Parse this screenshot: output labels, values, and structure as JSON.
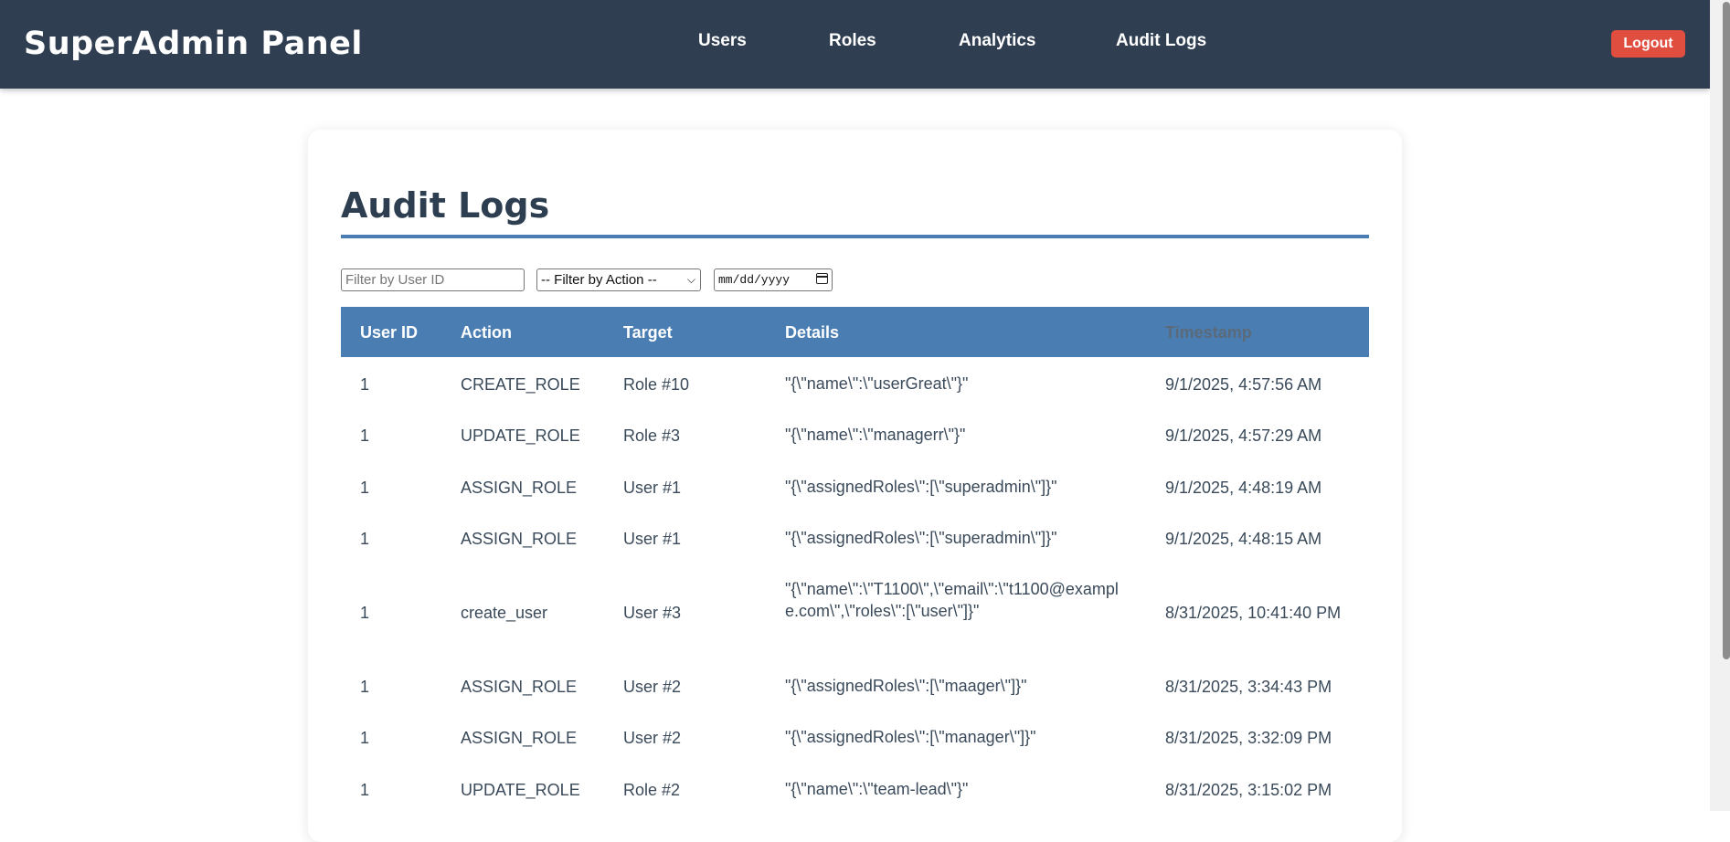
{
  "header": {
    "brand": "SuperAdmin Panel",
    "nav": [
      "Users",
      "Roles",
      "Analytics",
      "Audit Logs"
    ],
    "logout_label": "Logout"
  },
  "main": {
    "title": "Audit Logs",
    "filters": {
      "user_placeholder": "Filter by User ID",
      "action_selected": "-- Filter by Action --",
      "date_placeholder": "mm/dd/yyyy"
    },
    "table": {
      "columns": [
        "User ID",
        "Action",
        "Target",
        "Details",
        "Timestamp"
      ],
      "rows": [
        {
          "user_id": "1",
          "action": "CREATE_ROLE",
          "target": "Role #10",
          "details": "\"{\\\"name\\\":\\\"userGreat\\\"}\"",
          "timestamp": "9/1/2025, 4:57:56 AM"
        },
        {
          "user_id": "1",
          "action": "UPDATE_ROLE",
          "target": "Role #3",
          "details": "\"{\\\"name\\\":\\\"managerr\\\"}\"",
          "timestamp": "9/1/2025, 4:57:29 AM"
        },
        {
          "user_id": "1",
          "action": "ASSIGN_ROLE",
          "target": "User #1",
          "details": "\"{\\\"assignedRoles\\\":[\\\"superadmin\\\"]}\"",
          "timestamp": "9/1/2025, 4:48:19 AM"
        },
        {
          "user_id": "1",
          "action": "ASSIGN_ROLE",
          "target": "User #1",
          "details": "\"{\\\"assignedRoles\\\":[\\\"superadmin\\\"]}\"",
          "timestamp": "9/1/2025, 4:48:15 AM"
        },
        {
          "user_id": "1",
          "action": "create_user",
          "target": "User #3",
          "details": "\"{\\\"name\\\":\\\"T1100\\\",\\\"email\\\":\\\"t1100@example.com\\\",\\\"roles\\\":[\\\"user\\\"]}\"",
          "timestamp": "8/31/2025, 10:41:40 PM"
        },
        {
          "user_id": "1",
          "action": "ASSIGN_ROLE",
          "target": "User #2",
          "details": "\"{\\\"assignedRoles\\\":[\\\"maager\\\"]}\"",
          "timestamp": "8/31/2025, 3:34:43 PM"
        },
        {
          "user_id": "1",
          "action": "ASSIGN_ROLE",
          "target": "User #2",
          "details": "\"{\\\"assignedRoles\\\":[\\\"manager\\\"]}\"",
          "timestamp": "8/31/2025, 3:32:09 PM"
        },
        {
          "user_id": "1",
          "action": "UPDATE_ROLE",
          "target": "Role #2",
          "details": "\"{\\\"name\\\":\\\"team-lead\\\"}\"",
          "timestamp": "8/31/2025, 3:15:02 PM"
        }
      ]
    }
  },
  "colors": {
    "header_bg": "#2f3e51",
    "accent": "#4a7eb3",
    "logout_bg": "#e04e3f",
    "title_text": "#2c3e50"
  }
}
